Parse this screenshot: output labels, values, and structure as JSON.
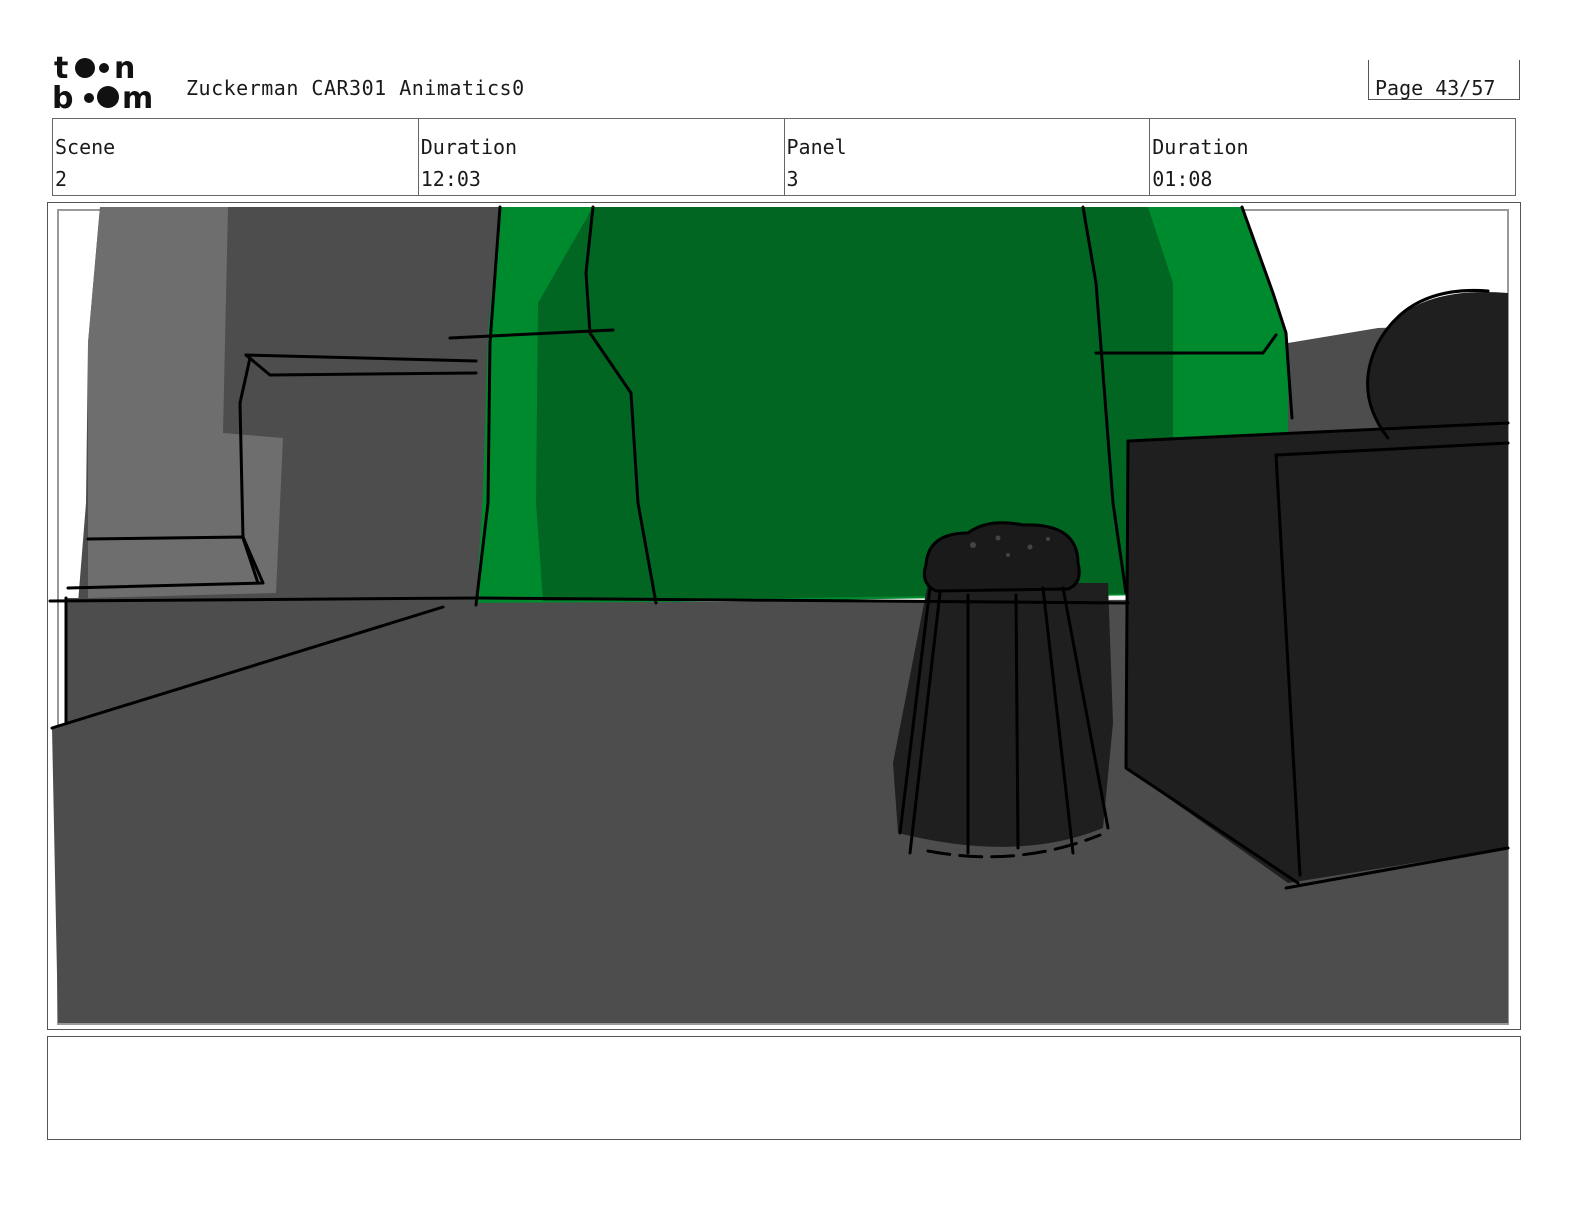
{
  "header": {
    "logo_icon": "toon-boom-logo",
    "project_title": "Zuckerman CAR301 Animatics0",
    "page_label": "Page 43/57"
  },
  "info": {
    "scene_label": "Scene",
    "scene_value": "2",
    "scene_duration_label": "Duration",
    "scene_duration_value": "12:03",
    "panel_label": "Panel",
    "panel_value": "3",
    "panel_duration_label": "Duration",
    "panel_duration_value": "01:08"
  },
  "panel": {
    "art_icon": "storyboard-sketch-image",
    "colors": {
      "wall_grey": "#4d4d4d",
      "light_grey": "#6e6e6e",
      "green_dark": "#006622",
      "green_light": "#008a2e",
      "object_black": "#1f1f1f"
    }
  },
  "caption": {
    "text": ""
  }
}
